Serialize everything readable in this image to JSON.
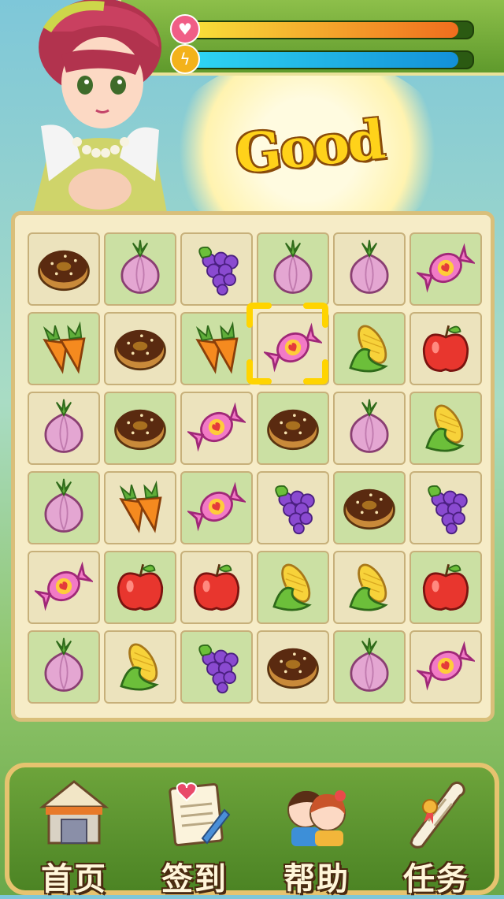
{
  "hud": {
    "health_fraction": 0.95,
    "energy_fraction": 0.95,
    "health_color_start": "#f7e33a",
    "health_color_end": "#f06d1e",
    "energy_color_start": "#2fd7f3",
    "energy_color_end": "#1390d8",
    "health_icon": "heart-icon",
    "energy_icon": "lightning-coin-icon"
  },
  "banner": {
    "text": "Good"
  },
  "board": {
    "rows": [
      [
        "donut",
        "onion",
        "grapes",
        "onion",
        "onion",
        "candy"
      ],
      [
        "carrot",
        "donut",
        "carrot",
        "candy",
        "corn",
        "apple"
      ],
      [
        "onion",
        "donut",
        "candy",
        "donut",
        "onion",
        "corn"
      ],
      [
        "onion",
        "carrot",
        "candy",
        "grapes",
        "donut",
        "grapes"
      ],
      [
        "candy",
        "apple",
        "apple",
        "corn",
        "corn",
        "apple"
      ],
      [
        "onion",
        "corn",
        "grapes",
        "donut",
        "onion",
        "candy"
      ]
    ],
    "tile_shades": [
      [
        "light",
        "green",
        "light",
        "green",
        "light",
        "green"
      ],
      [
        "green",
        "light",
        "green",
        "light",
        "green",
        "light"
      ],
      [
        "light",
        "green",
        "light",
        "green",
        "light",
        "green"
      ],
      [
        "green",
        "light",
        "green",
        "light",
        "green",
        "light"
      ],
      [
        "light",
        "green",
        "light",
        "green",
        "light",
        "green"
      ],
      [
        "green",
        "light",
        "green",
        "light",
        "green",
        "light"
      ]
    ],
    "selected": {
      "row": 1,
      "col": 3
    }
  },
  "menu": {
    "items": [
      {
        "label": "首页",
        "icon": "home-shop-icon"
      },
      {
        "label": "签到",
        "icon": "checkin-notepad-icon"
      },
      {
        "label": "帮助",
        "icon": "help-kids-icon"
      },
      {
        "label": "任务",
        "icon": "task-scroll-icon"
      }
    ]
  }
}
